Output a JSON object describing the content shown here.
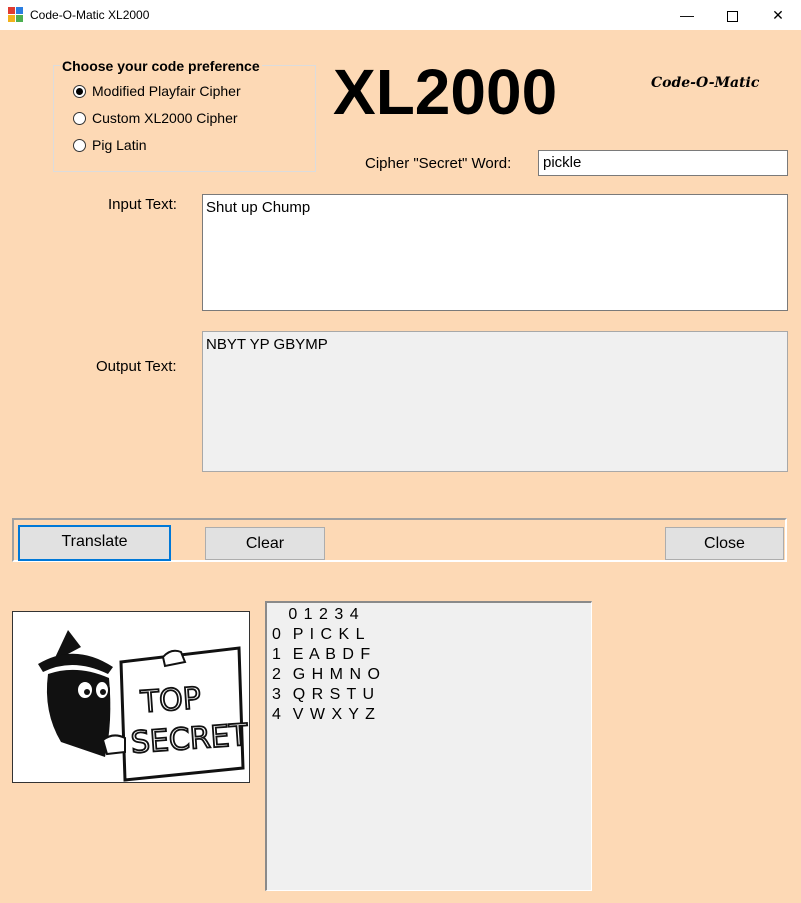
{
  "window": {
    "title": "Code-O-Matic XL2000",
    "minimize_glyph": "—",
    "close_glyph": "✕"
  },
  "preference_group": {
    "legend": "Choose your code preference",
    "options": [
      {
        "label": "Modified Playfair Cipher",
        "selected": true
      },
      {
        "label": "Custom XL2000 Cipher",
        "selected": false
      },
      {
        "label": "Pig Latin",
        "selected": false
      }
    ]
  },
  "header": {
    "big_title": "XL2000",
    "brand": "Code-O-Matic"
  },
  "secret_word": {
    "label": "Cipher \"Secret\" Word:",
    "value": "pickle"
  },
  "input": {
    "label": "Input Text:",
    "value": "Shut up Chump"
  },
  "output": {
    "label": "Output Text:",
    "value": "NBYT YP GBYMP"
  },
  "buttons": {
    "translate": "Translate",
    "clear": "Clear",
    "close": "Close"
  },
  "picture": {
    "icon": "top-secret-spy-image",
    "lettering": "TOP SECRET"
  },
  "cipher_grid": {
    "header": "   0 1 2 3 4",
    "rows": [
      "0  P I C K L",
      "1  E A B D F",
      "2  G H M N O",
      "3  Q R S T U",
      "4  V W X Y Z"
    ]
  },
  "colors": {
    "form_background": "#fdd9b5",
    "focus_border": "#0078d7"
  }
}
